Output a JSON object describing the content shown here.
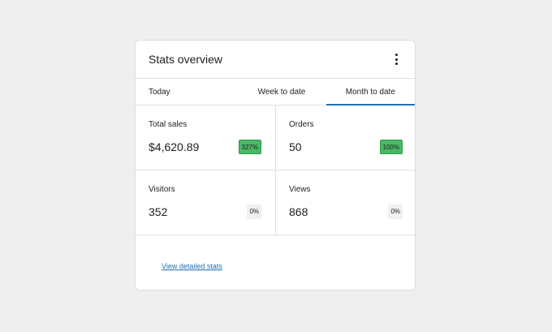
{
  "card": {
    "title": "Stats overview",
    "menu_icon": "more-vertical-icon"
  },
  "tabs": [
    {
      "label": "Today",
      "active": false
    },
    {
      "label": "Week to date",
      "active": false
    },
    {
      "label": "Month to date",
      "active": true
    }
  ],
  "stats": [
    {
      "label": "Total sales",
      "value": "$4,620.89",
      "delta": "327%",
      "trend": "up"
    },
    {
      "label": "Orders",
      "value": "50",
      "delta": "100%",
      "trend": "up"
    },
    {
      "label": "Visitors",
      "value": "352",
      "delta": "0%",
      "trend": "neutral"
    },
    {
      "label": "Views",
      "value": "868",
      "delta": "0%",
      "trend": "neutral"
    }
  ],
  "footer": {
    "link_label": "View detailed stats"
  },
  "colors": {
    "background": "#efeff0",
    "accent": "#2271b1",
    "positive": "#4ab866",
    "neutral": "#f0f0f0"
  }
}
